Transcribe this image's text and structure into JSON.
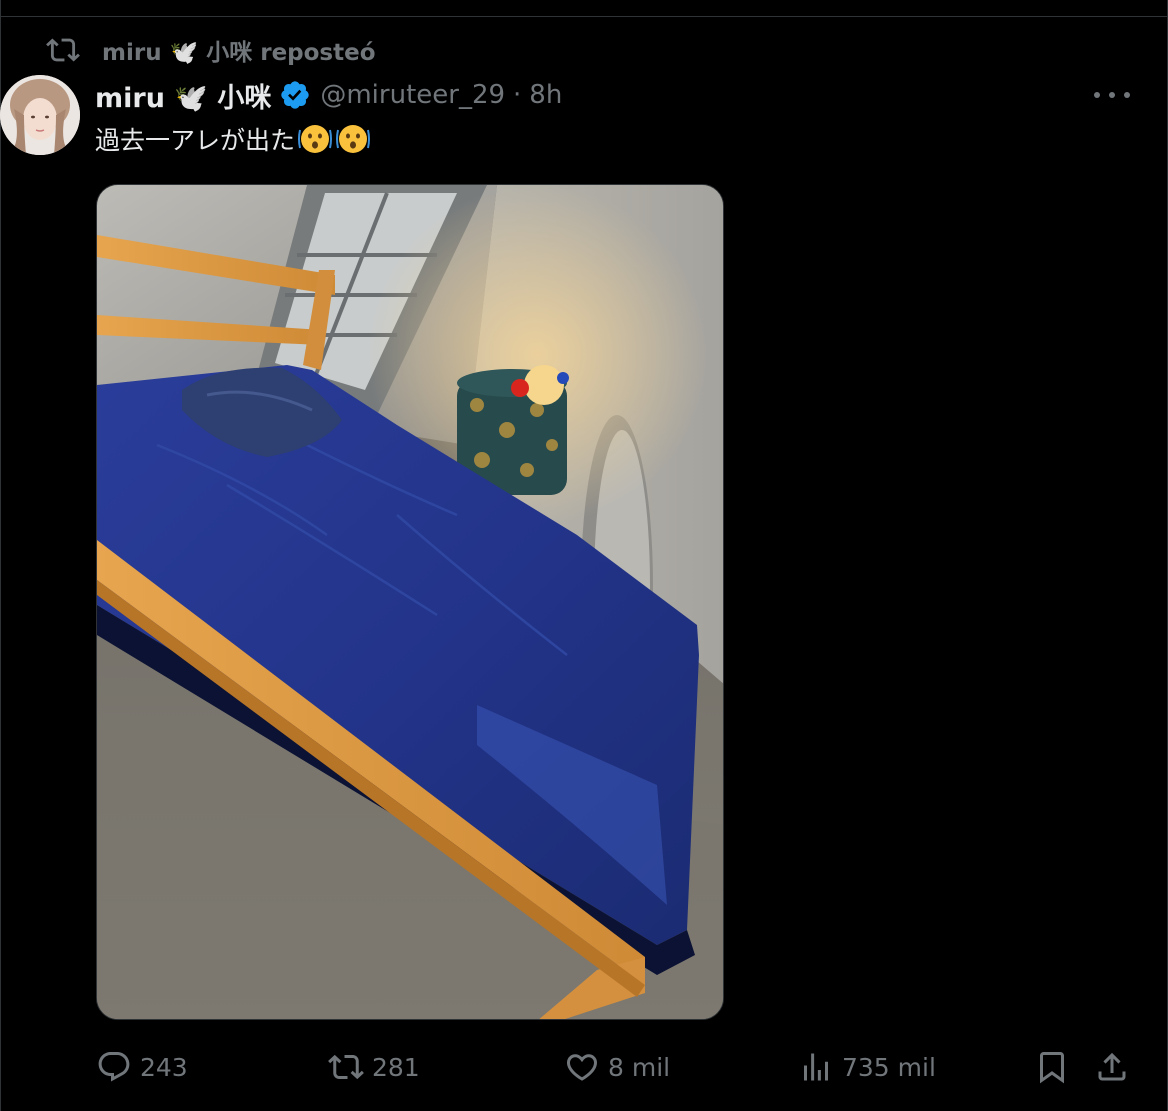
{
  "repost": {
    "text": "miru 🕊️ 小咪 reposteó"
  },
  "author": {
    "name": "miru 🕊️ 小咪",
    "handle": "@miruteer_29",
    "separator": "·",
    "time": "8h"
  },
  "tweet": {
    "text": "過去一アレが出た"
  },
  "actions": {
    "replies": "243",
    "reposts": "281",
    "likes": "8 mil",
    "views": "735 mil"
  },
  "colors": {
    "background": "#000000",
    "text_primary": "#e7e9ea",
    "text_secondary": "#71767b",
    "verified": "#1d9bf0",
    "divider": "#2f3336"
  },
  "icons": [
    "retweet-icon",
    "verified-badge-icon",
    "more-icon",
    "reply-icon",
    "like-icon",
    "views-icon",
    "bookmark-icon",
    "share-icon",
    "astonished-emoji"
  ]
}
